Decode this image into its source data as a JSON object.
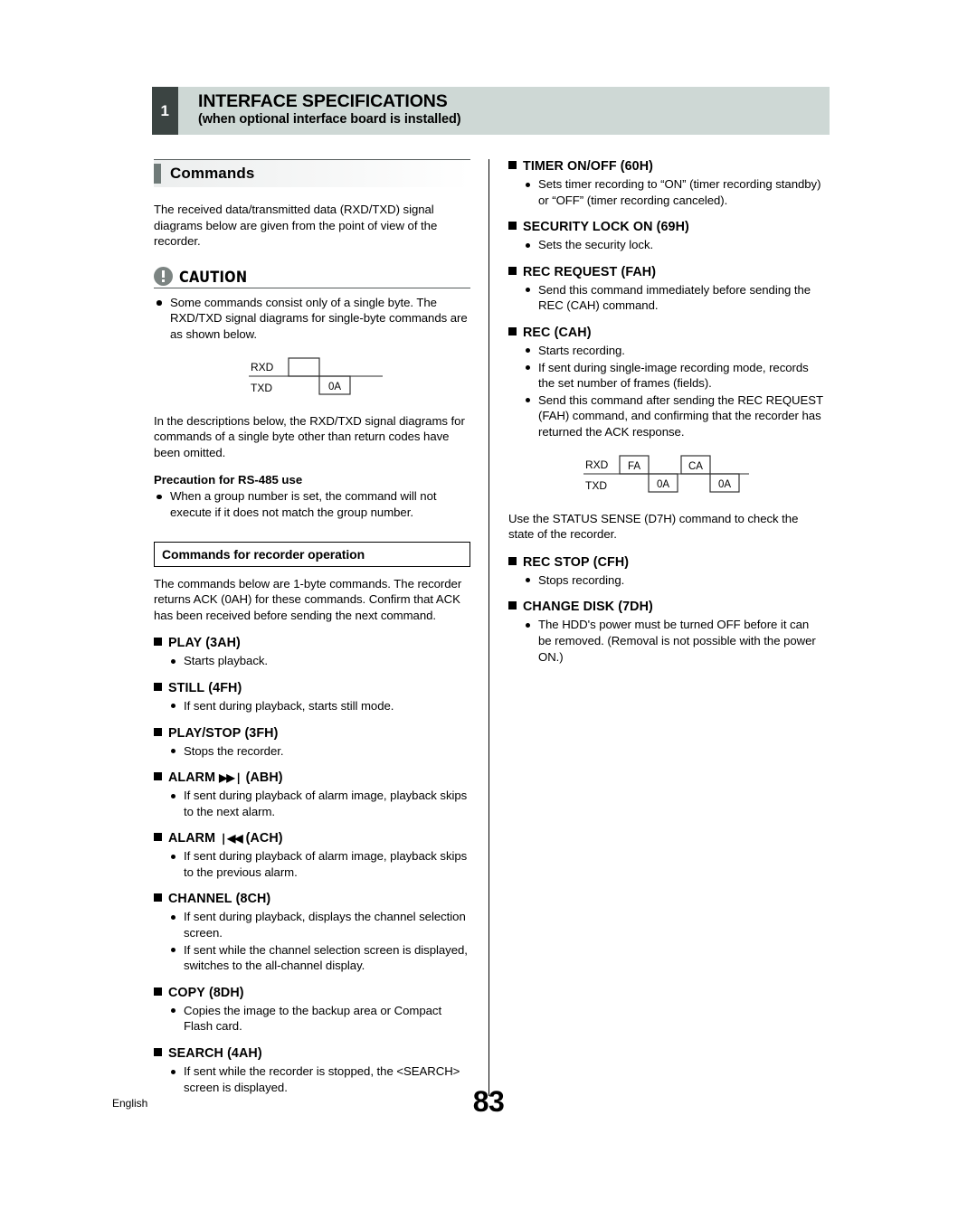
{
  "header": {
    "chapter_number": "1",
    "title": "INTERFACE SPECIFICATIONS",
    "subtitle": "(when optional interface board is installed)"
  },
  "section": {
    "title": "Commands",
    "intro": "The received data/transmitted data (RXD/TXD) signal diagrams below are given from the point of view of the recorder."
  },
  "caution": {
    "label": "CAUTION",
    "icon": "exclamation-circle-icon",
    "bullets": [
      "Some commands consist only of a single byte. The RXD/TXD signal diagrams for single-byte commands are as shown below."
    ],
    "after_text": "In the descriptions below, the RXD/TXD signal diagrams for commands of a single byte other than return codes have been omitted.",
    "precaution_title": "Precaution for RS-485 use",
    "precaution_bullets": [
      "When a group number is set, the command will not execute if it does not match the group number."
    ]
  },
  "diagram1": {
    "rxd_label": "RXD",
    "txd_label": "TXD",
    "rxd_boxes": [
      " "
    ],
    "txd_boxes": [
      "0A"
    ]
  },
  "diagram2": {
    "rxd_label": "RXD",
    "txd_label": "TXD",
    "rxd_boxes": [
      "FA",
      "CA"
    ],
    "txd_boxes": [
      "0A",
      "0A"
    ]
  },
  "recorder_ops": {
    "boxed_title": "Commands for recorder operation",
    "intro": "The commands below are 1-byte commands. The recorder returns ACK (0AH) for these commands. Confirm that ACK has been received before sending the next command.",
    "commands": [
      {
        "name": "PLAY",
        "glyph": "",
        "code": "(3AH)",
        "bullets": [
          "Starts playback."
        ]
      },
      {
        "name": "STILL",
        "glyph": "",
        "code": "(4FH)",
        "bullets": [
          "If sent during playback, starts still mode."
        ]
      },
      {
        "name": "PLAY/STOP",
        "glyph": "",
        "code": "(3FH)",
        "bullets": [
          "Stops the recorder."
        ]
      },
      {
        "name": "ALARM",
        "glyph": "▶▶❘",
        "glyph_name": "skip-forward-icon",
        "code": "(ABH)",
        "bullets": [
          "If sent during playback of alarm image, playback skips to the next alarm."
        ]
      },
      {
        "name": "ALARM",
        "glyph": "❘◀◀",
        "glyph_name": "skip-backward-icon",
        "code": "(ACH)",
        "bullets": [
          "If sent during playback of alarm image, playback skips to the previous alarm."
        ]
      },
      {
        "name": "CHANNEL",
        "glyph": "",
        "code": "(8CH)",
        "bullets": [
          "If sent during playback, displays the channel selection screen.",
          "If sent while the channel selection screen is displayed, switches to the all-channel display."
        ]
      },
      {
        "name": "COPY",
        "glyph": "",
        "code": "(8DH)",
        "bullets": [
          "Copies the image to the backup area or Compact Flash card."
        ]
      },
      {
        "name": "SEARCH",
        "glyph": "",
        "code": "(4AH)",
        "bullets": [
          "If sent while the recorder is stopped, the <SEARCH> screen is displayed."
        ]
      }
    ]
  },
  "right_column": {
    "commands_top": [
      {
        "name": "TIMER ON/OFF",
        "code": "(60H)",
        "bullets": [
          "Sets timer recording to “ON” (timer recording standby) or “OFF” (timer recording canceled)."
        ]
      },
      {
        "name": "SECURITY LOCK ON",
        "code": "(69H)",
        "bullets": [
          "Sets the security lock."
        ]
      },
      {
        "name": "REC REQUEST",
        "code": "(FAH)",
        "bullets": [
          "Send this command immediately before sending the REC (CAH) command."
        ]
      },
      {
        "name": "REC",
        "code": "(CAH)",
        "bullets": [
          "Starts recording.",
          "If sent during single-image recording mode, records the set number of frames (fields).",
          "Send this command after sending the REC REQUEST (FAH) command, and confirming that the recorder has returned the ACK response."
        ]
      }
    ],
    "status_note": "Use the STATUS SENSE (D7H) command to check the state of the recorder.",
    "commands_bottom": [
      {
        "name": "REC STOP",
        "code": "(CFH)",
        "bullets": [
          "Stops recording."
        ]
      },
      {
        "name": "CHANGE DISK",
        "code": "(7DH)",
        "bullets": [
          "The HDD's power must be turned OFF before it can be removed. (Removal is not possible with the power ON.)"
        ]
      }
    ]
  },
  "footer": {
    "language": "English",
    "page_number": "83"
  }
}
